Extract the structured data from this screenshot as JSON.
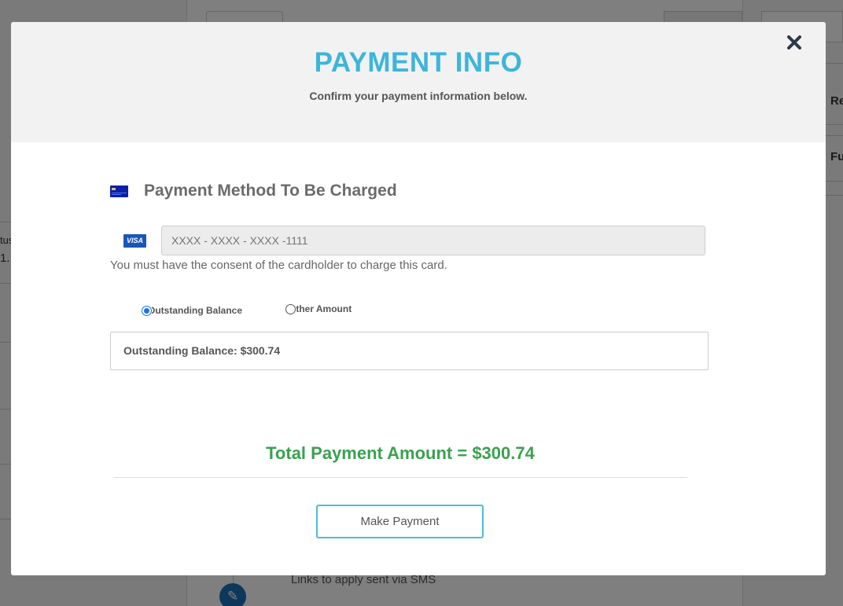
{
  "background": {
    "right_items": [
      "Re",
      "Fu"
    ],
    "left_items": [
      "tus",
      "1."
    ],
    "timeline_text": "Links to apply sent via SMS"
  },
  "modal": {
    "title": "PAYMENT INFO",
    "subtitle": "Confirm your payment information below.",
    "close_icon": "close-x-icon",
    "section_title": "Payment Method To Be Charged",
    "card_brand": "VISA",
    "card_number_placeholder": "XXXX - XXXX - XXXX -1111",
    "consent_text": "You must have the consent of the cardholder to charge this card.",
    "payment_options": [
      {
        "label": "Outstanding Balance",
        "checked": true
      },
      {
        "label": "Other Amount",
        "checked": false
      }
    ],
    "balance_text": "Outstanding Balance: $300.74",
    "total_text": "Total Payment Amount = $300.74",
    "make_payment_label": "Make Payment"
  },
  "colors": {
    "title": "#3db5db",
    "total": "#3aa14f",
    "button_border": "#4dbcd4",
    "visa": "#1a56b8"
  }
}
